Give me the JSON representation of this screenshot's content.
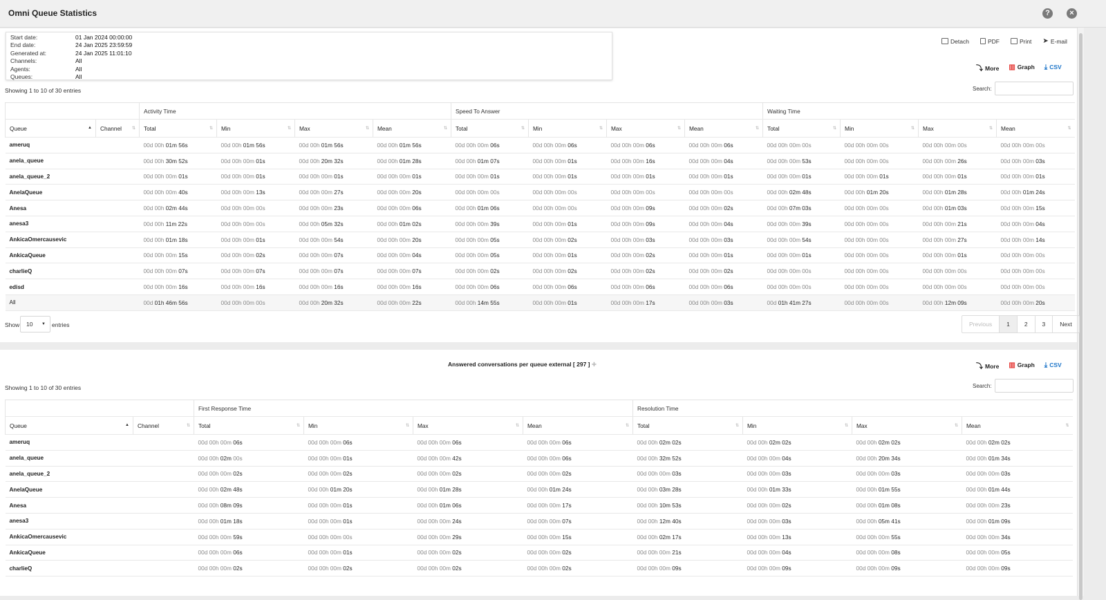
{
  "window": {
    "title": "Omni Queue Statistics",
    "help_icon": "?",
    "close_icon": "×"
  },
  "report_info": [
    {
      "label": "Start date:",
      "value": "01 Jan 2024 00:00:00"
    },
    {
      "label": "End date:",
      "value": "24 Jan 2025 23:59:59"
    },
    {
      "label": "Generated at:",
      "value": "24 Jan 2025 11:01:10"
    },
    {
      "label": "Channels:",
      "value": "All"
    },
    {
      "label": "Agents:",
      "value": "All"
    },
    {
      "label": "Queues:",
      "value": "All"
    }
  ],
  "toolbar": {
    "detach": "Detach",
    "pdf": "PDF",
    "print": "Print",
    "email": "E-mail"
  },
  "actions": {
    "more": "More",
    "graph": "Graph",
    "csv": "CSV"
  },
  "colors": {
    "csv": "#1a73c8",
    "graph_icon": "#e53935"
  },
  "table1": {
    "showing": "Showing 1 to 10 of 30 entries",
    "search_label": "Search:",
    "groups": [
      "Activity Time",
      "Speed To Answer",
      "Waiting Time"
    ],
    "columns": [
      "Queue",
      "Channel",
      "Total",
      "Min",
      "Max",
      "Mean",
      "Total",
      "Min",
      "Max",
      "Mean",
      "Total",
      "Min",
      "Max",
      "Mean"
    ],
    "rows": [
      [
        "ameruq",
        "",
        "00d 00h |01m 56s",
        "00d 00h |01m 56s",
        "00d 00h |01m 56s",
        "00d 00h |01m 56s",
        "00d 00h 00m |06s",
        "00d 00h 00m |06s",
        "00d 00h 00m |06s",
        "00d 00h 00m |06s",
        "00d 00h 00m 00s|",
        "00d 00h 00m 00s|",
        "00d 00h 00m 00s|",
        "00d 00h 00m 00s|"
      ],
      [
        "anela_queue",
        "",
        "00d 00h |30m 52s",
        "00d 00h 00m |01s",
        "00d 00h |20m 32s",
        "00d 00h |01m 28s",
        "00d 00h |01m 07s",
        "00d 00h 00m |01s",
        "00d 00h 00m |16s",
        "00d 00h 00m |04s",
        "00d 00h 00m |53s",
        "00d 00h 00m 00s|",
        "00d 00h 00m |26s",
        "00d 00h 00m |03s"
      ],
      [
        "anela_queue_2",
        "",
        "00d 00h 00m |01s",
        "00d 00h 00m |01s",
        "00d 00h 00m |01s",
        "00d 00h 00m |01s",
        "00d 00h 00m |01s",
        "00d 00h 00m |01s",
        "00d 00h 00m |01s",
        "00d 00h 00m |01s",
        "00d 00h 00m |01s",
        "00d 00h 00m |01s",
        "00d 00h 00m |01s",
        "00d 00h 00m |01s"
      ],
      [
        "AnelaQueue",
        "",
        "00d 00h 00m |40s",
        "00d 00h 00m |13s",
        "00d 00h 00m |27s",
        "00d 00h 00m |20s",
        "00d 00h 00m 00s|",
        "00d 00h 00m 00s|",
        "00d 00h 00m 00s|",
        "00d 00h 00m 00s|",
        "00d 00h |02m 48s",
        "00d 00h |01m 20s",
        "00d 00h |01m 28s",
        "00d 00h |01m 24s"
      ],
      [
        "Anesa",
        "",
        "00d 00h |02m 44s",
        "00d 00h 00m 00s|",
        "00d 00h 00m |23s",
        "00d 00h 00m |06s",
        "00d 00h |01m 06s",
        "00d 00h 00m 00s|",
        "00d 00h 00m |09s",
        "00d 00h 00m |02s",
        "00d 00h |07m 03s",
        "00d 00h 00m 00s|",
        "00d 00h |01m 03s",
        "00d 00h 00m |15s"
      ],
      [
        "anesa3",
        "",
        "00d 00h |11m 22s",
        "00d 00h 00m 00s|",
        "00d 00h |05m 32s",
        "00d 00h |01m 02s",
        "00d 00h 00m |39s",
        "00d 00h 00m |01s",
        "00d 00h 00m |09s",
        "00d 00h 00m |04s",
        "00d 00h 00m |39s",
        "00d 00h 00m 00s|",
        "00d 00h 00m |21s",
        "00d 00h 00m |04s"
      ],
      [
        "AnkicaOmercausevic",
        "",
        "00d 00h |01m 18s",
        "00d 00h 00m |01s",
        "00d 00h 00m |54s",
        "00d 00h 00m |20s",
        "00d 00h 00m |05s",
        "00d 00h 00m |02s",
        "00d 00h 00m |03s",
        "00d 00h 00m |03s",
        "00d 00h 00m |54s",
        "00d 00h 00m 00s|",
        "00d 00h 00m |27s",
        "00d 00h 00m |14s"
      ],
      [
        "AnkicaQueue",
        "",
        "00d 00h 00m |15s",
        "00d 00h 00m |02s",
        "00d 00h 00m |07s",
        "00d 00h 00m |04s",
        "00d 00h 00m |05s",
        "00d 00h 00m |01s",
        "00d 00h 00m |02s",
        "00d 00h 00m |01s",
        "00d 00h 00m |01s",
        "00d 00h 00m 00s|",
        "00d 00h 00m |01s",
        "00d 00h 00m 00s|"
      ],
      [
        "charlieQ",
        "",
        "00d 00h 00m |07s",
        "00d 00h 00m |07s",
        "00d 00h 00m |07s",
        "00d 00h 00m |07s",
        "00d 00h 00m |02s",
        "00d 00h 00m |02s",
        "00d 00h 00m |02s",
        "00d 00h 00m |02s",
        "00d 00h 00m 00s|",
        "00d 00h 00m 00s|",
        "00d 00h 00m 00s|",
        "00d 00h 00m 00s|"
      ],
      [
        "edisd",
        "",
        "00d 00h 00m |16s",
        "00d 00h 00m |16s",
        "00d 00h 00m |16s",
        "00d 00h 00m |16s",
        "00d 00h 00m |06s",
        "00d 00h 00m |06s",
        "00d 00h 00m |06s",
        "00d 00h 00m |06s",
        "00d 00h 00m 00s|",
        "00d 00h 00m 00s|",
        "00d 00h 00m 00s|",
        "00d 00h 00m 00s|"
      ]
    ],
    "total_row": [
      "All",
      "",
      "00d |01h 46m 56s",
      "00d 00h 00m 00s|",
      "00d 00h |20m 32s",
      "00d 00h 00m |22s",
      "00d 00h |14m 55s",
      "00d 00h 00m |01s",
      "00d 00h 00m |17s",
      "00d 00h 00m |03s",
      "00d |01h 41m 27s",
      "00d 00h 00m 00s|",
      "00d 00h |12m 09s",
      "00d 00h 00m |20s"
    ],
    "pagination": [
      "Previous",
      "1",
      "2",
      "3",
      "Next"
    ],
    "show_label": "Show",
    "entries_label": "entries",
    "page_size": "10"
  },
  "table2": {
    "title": "Answered conversations per queue external [ 297 ]",
    "showing": "Showing 1 to 10 of 30 entries",
    "search_label": "Search:",
    "groups": [
      "First Response Time",
      "Resolution Time"
    ],
    "columns": [
      "Queue",
      "Channel",
      "Total",
      "Min",
      "Max",
      "Mean",
      "Total",
      "Min",
      "Max",
      "Mean"
    ],
    "rows": [
      [
        "ameruq",
        "",
        "00d 00h 00m |06s",
        "00d 00h 00m |06s",
        "00d 00h 00m |06s",
        "00d 00h 00m |06s",
        "00d 00h |02m 02s",
        "00d 00h |02m 02s",
        "00d 00h |02m 02s",
        "00d 00h |02m 02s"
      ],
      [
        "anela_queue",
        "",
        "00d 00h |02m |00s",
        "00d 00h 00m |01s",
        "00d 00h 00m |42s",
        "00d 00h 00m |06s",
        "00d 00h |32m 52s",
        "00d 00h 00m |04s",
        "00d 00h |20m 34s",
        "00d 00h |01m 34s"
      ],
      [
        "anela_queue_2",
        "",
        "00d 00h 00m |02s",
        "00d 00h 00m |02s",
        "00d 00h 00m |02s",
        "00d 00h 00m |02s",
        "00d 00h 00m |03s",
        "00d 00h 00m |03s",
        "00d 00h 00m |03s",
        "00d 00h 00m |03s"
      ],
      [
        "AnelaQueue",
        "",
        "00d 00h |02m 48s",
        "00d 00h |01m 20s",
        "00d 00h |01m 28s",
        "00d 00h |01m 24s",
        "00d 00h |03m 28s",
        "00d 00h |01m 33s",
        "00d 00h |01m 55s",
        "00d 00h |01m 44s"
      ],
      [
        "Anesa",
        "",
        "00d 00h |08m 09s",
        "00d 00h 00m |01s",
        "00d 00h |01m 06s",
        "00d 00h 00m |17s",
        "00d 00h |10m 53s",
        "00d 00h 00m |02s",
        "00d 00h |01m 08s",
        "00d 00h 00m |23s"
      ],
      [
        "anesa3",
        "",
        "00d 00h |01m 18s",
        "00d 00h 00m |01s",
        "00d 00h 00m |24s",
        "00d 00h 00m |07s",
        "00d 00h |12m 40s",
        "00d 00h 00m |03s",
        "00d 00h |05m 41s",
        "00d 00h |01m 09s"
      ],
      [
        "AnkicaOmercausevic",
        "",
        "00d 00h 00m |59s",
        "00d 00h 00m 00s|",
        "00d 00h 00m |29s",
        "00d 00h 00m |15s",
        "00d 00h |02m 17s",
        "00d 00h 00m |13s",
        "00d 00h 00m |55s",
        "00d 00h 00m |34s"
      ],
      [
        "AnkicaQueue",
        "",
        "00d 00h 00m |06s",
        "00d 00h 00m |01s",
        "00d 00h 00m |02s",
        "00d 00h 00m |02s",
        "00d 00h 00m |21s",
        "00d 00h 00m |04s",
        "00d 00h 00m |08s",
        "00d 00h 00m |05s"
      ],
      [
        "charlieQ",
        "",
        "00d 00h 00m |02s",
        "00d 00h 00m |02s",
        "00d 00h 00m |02s",
        "00d 00h 00m |02s",
        "00d 00h 00m |09s",
        "00d 00h 00m |09s",
        "00d 00h 00m |09s",
        "00d 00h 00m |09s"
      ]
    ]
  }
}
